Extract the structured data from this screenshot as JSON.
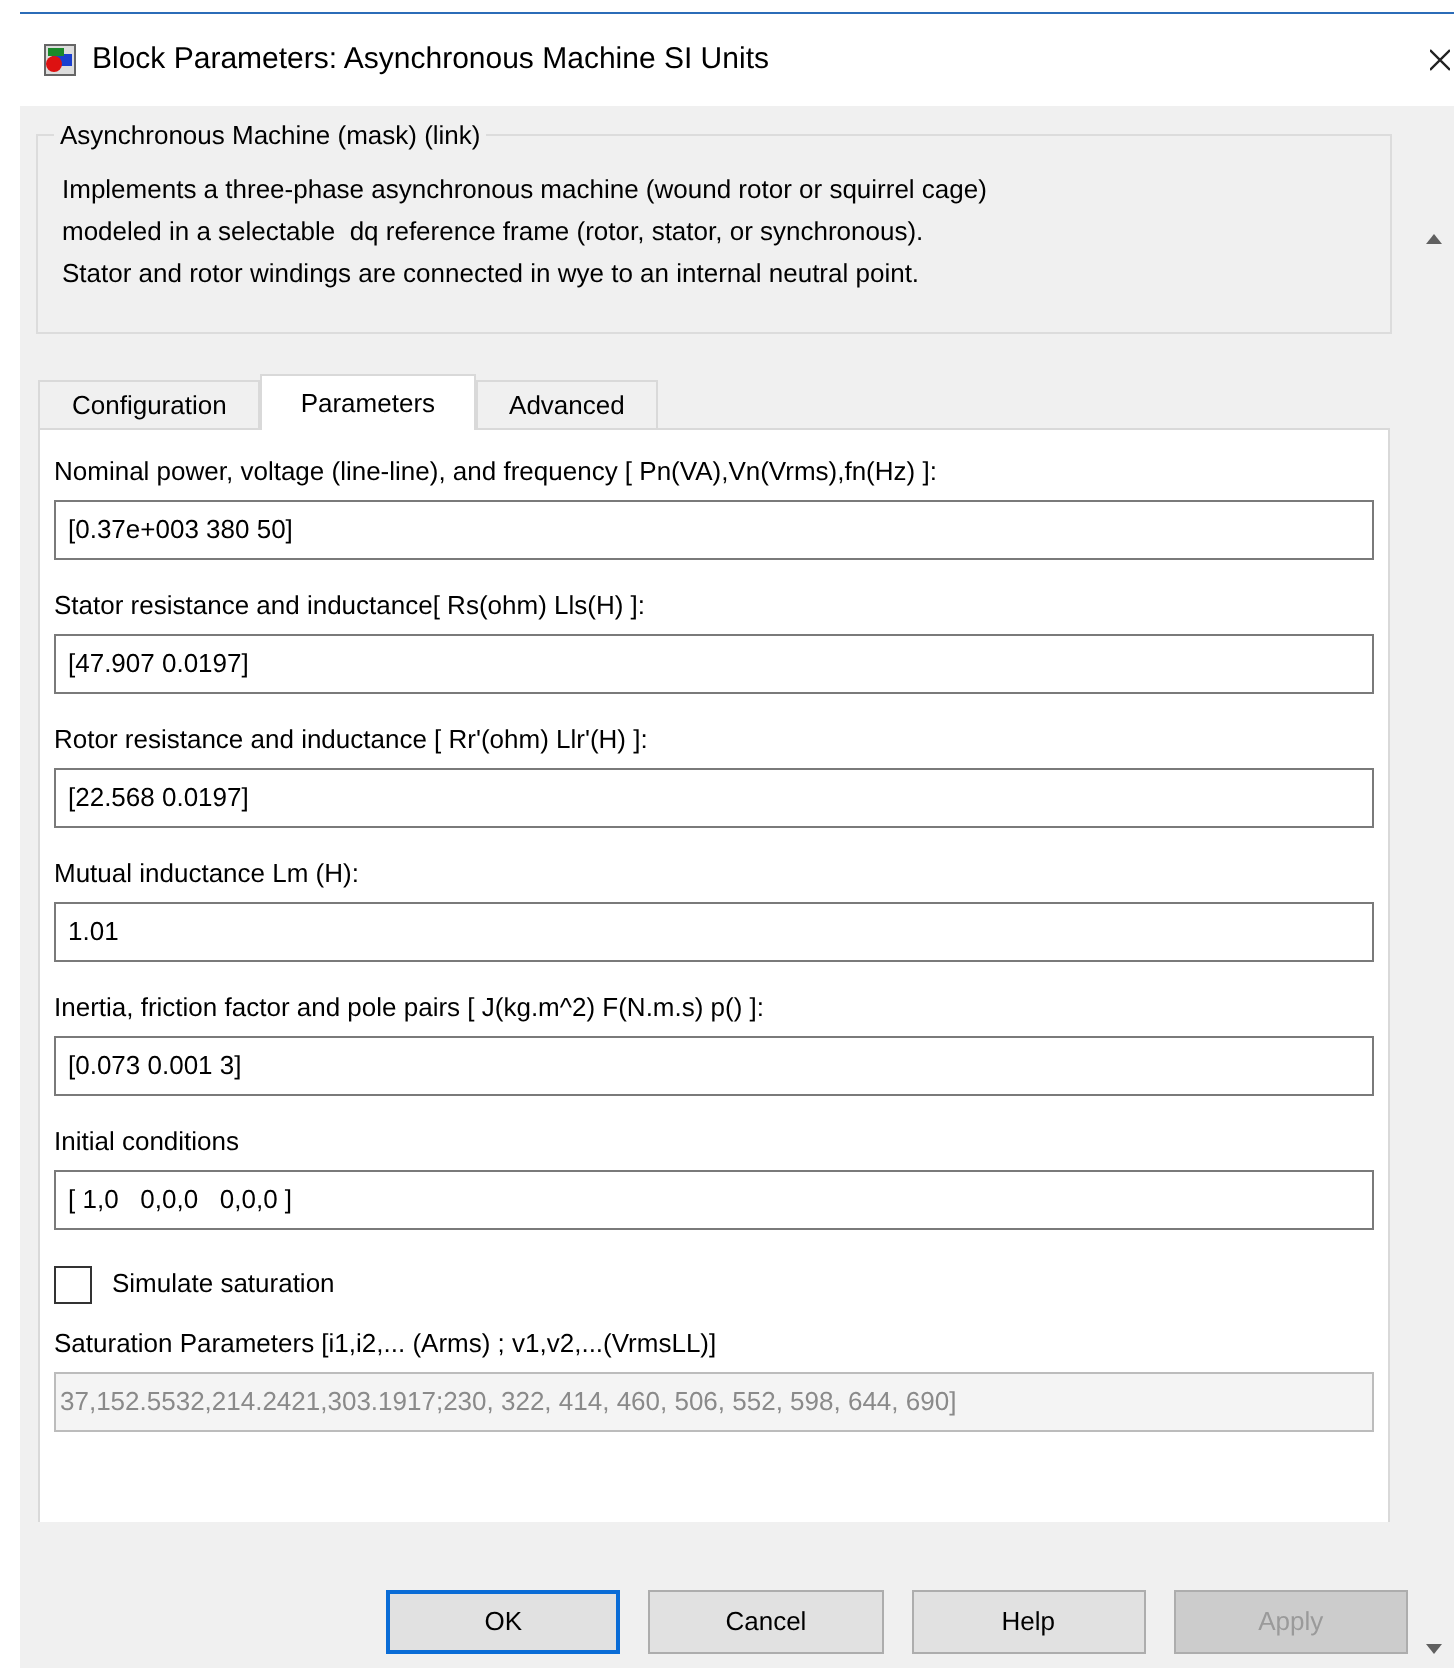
{
  "window": {
    "title": "Block Parameters: Asynchronous Machine SI Units"
  },
  "group": {
    "title": "Asynchronous Machine (mask) (link)",
    "description": [
      "Implements a three-phase asynchronous machine (wound rotor or squirrel cage)",
      "modeled in a selectable  dq reference frame (rotor, stator, or synchronous).",
      "Stator and rotor windings are connected in wye to an internal neutral point."
    ]
  },
  "tabs": [
    {
      "label": "Configuration",
      "selected": false
    },
    {
      "label": "Parameters",
      "selected": true
    },
    {
      "label": "Advanced",
      "selected": false
    }
  ],
  "parameters": [
    {
      "kind": "field",
      "label": "Nominal power, voltage (line-line), and frequency [ Pn(VA),Vn(Vrms),fn(Hz) ]:",
      "value": "[0.37e+003 380 50]",
      "disabled": false
    },
    {
      "kind": "field",
      "label": "Stator resistance and inductance[ Rs(ohm)  Lls(H) ]:",
      "value": "[47.907 0.0197]",
      "disabled": false
    },
    {
      "kind": "field",
      "label": "Rotor resistance and inductance [ Rr'(ohm)  Llr'(H) ]:",
      "value": "[22.568 0.0197]",
      "disabled": false
    },
    {
      "kind": "field",
      "label": "Mutual inductance Lm (H):",
      "value": "1.01",
      "disabled": false
    },
    {
      "kind": "field",
      "label": "Inertia, friction factor and pole pairs [ J(kg.m^2)  F(N.m.s)  p() ]:",
      "value": "[0.073 0.001 3]",
      "disabled": false
    },
    {
      "kind": "field",
      "label": "Initial conditions",
      "value": "[ 1,0   0,0,0   0,0,0 ]",
      "disabled": false
    },
    {
      "kind": "checkbox",
      "label": "Simulate saturation",
      "checked": false
    },
    {
      "kind": "field",
      "label": "Saturation Parameters [i1,i2,... (Arms) ; v1,v2,...(VrmsLL)]",
      "value": "37,152.5532,214.2421,303.1917;230, 322, 414, 460, 506, 552, 598, 644, 690]",
      "disabled": true
    }
  ],
  "buttons": [
    {
      "label": "OK",
      "default": true,
      "disabled": false
    },
    {
      "label": "Cancel",
      "default": false,
      "disabled": false
    },
    {
      "label": "Help",
      "default": false,
      "disabled": false
    },
    {
      "label": "Apply",
      "default": false,
      "disabled": true
    }
  ]
}
